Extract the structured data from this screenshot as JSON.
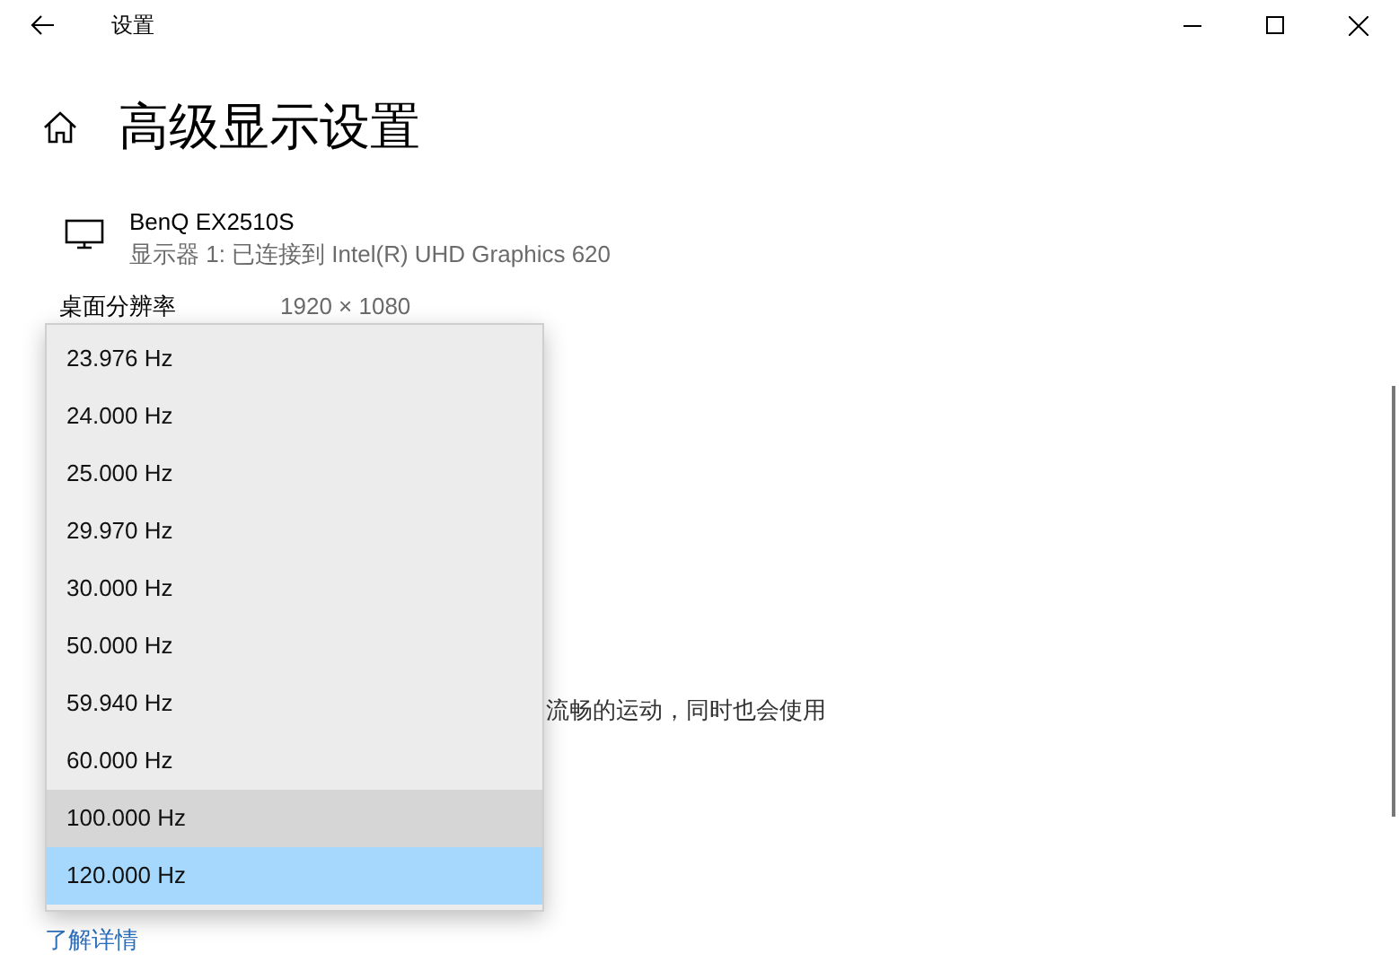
{
  "window": {
    "title": "设置"
  },
  "heading": "高级显示设置",
  "display": {
    "name": "BenQ EX2510S",
    "description": "显示器 1: 已连接到 Intel(R) UHD Graphics 620"
  },
  "resolution": {
    "label": "桌面分辨率",
    "value": "1920 × 1080"
  },
  "partial_text": "流畅的运动，同时也会使用",
  "refresh_dropdown": {
    "options": [
      {
        "label": "23.976 Hz",
        "selected": false,
        "hovered": false
      },
      {
        "label": "24.000 Hz",
        "selected": false,
        "hovered": false
      },
      {
        "label": "25.000 Hz",
        "selected": false,
        "hovered": false
      },
      {
        "label": "29.970 Hz",
        "selected": false,
        "hovered": false
      },
      {
        "label": "30.000 Hz",
        "selected": false,
        "hovered": false
      },
      {
        "label": "50.000 Hz",
        "selected": false,
        "hovered": false
      },
      {
        "label": "59.940 Hz",
        "selected": false,
        "hovered": false
      },
      {
        "label": "60.000 Hz",
        "selected": false,
        "hovered": false
      },
      {
        "label": "100.000 Hz",
        "selected": false,
        "hovered": true
      },
      {
        "label": "120.000 Hz",
        "selected": true,
        "hovered": false
      }
    ]
  },
  "link": "了解详情"
}
